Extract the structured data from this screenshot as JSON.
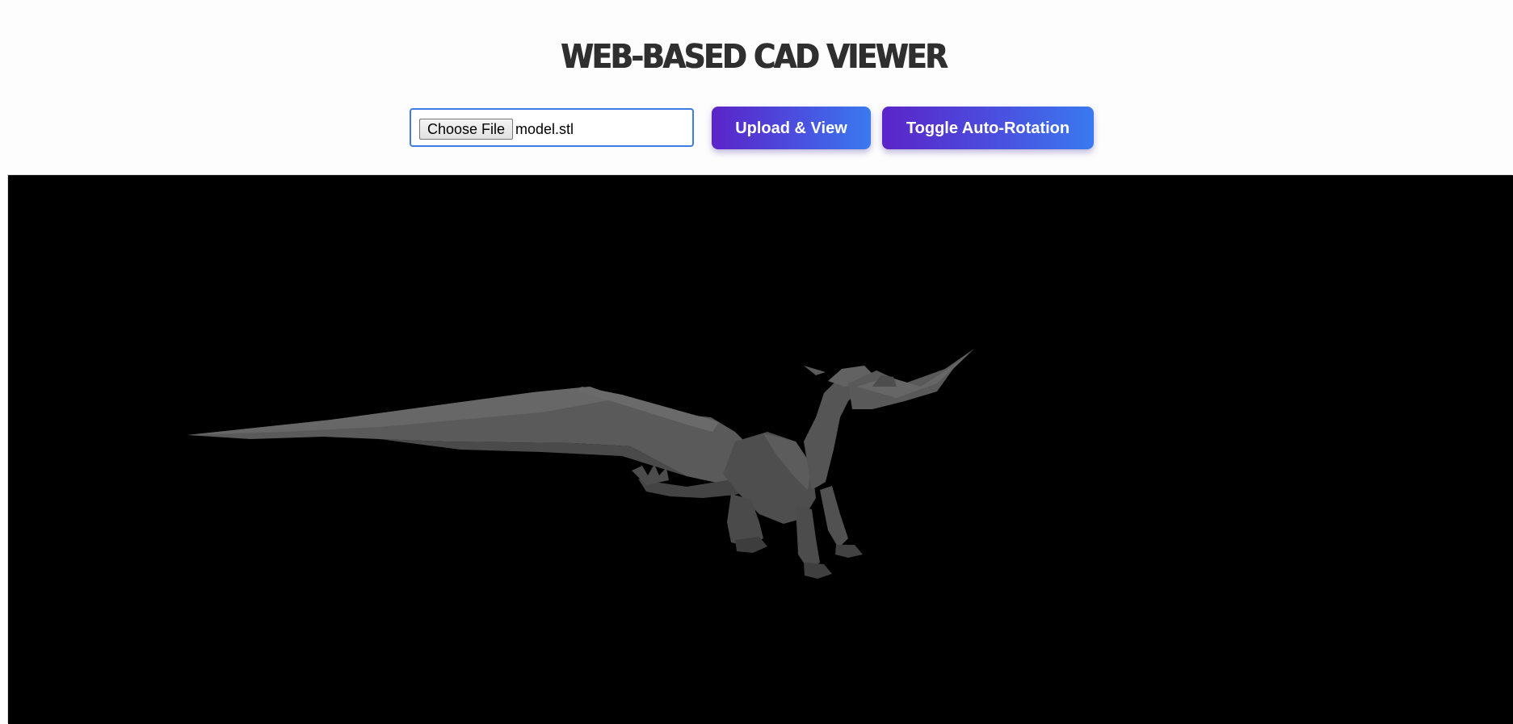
{
  "header": {
    "title": "WEB-BASED CAD VIEWER"
  },
  "controls": {
    "choose_file_label": "Choose File",
    "selected_file": "model.stl",
    "upload_label": "Upload & View",
    "toggle_rotation_label": "Toggle Auto-Rotation"
  },
  "viewer": {
    "background": "#000000",
    "model_color": "#5a5a5a",
    "model": "dragon-model"
  },
  "colors": {
    "title": "#2f2f2f",
    "accent_border": "#3f7be6",
    "button_gradient_start": "#5b24c9",
    "button_gradient_end": "#3a7af0"
  }
}
